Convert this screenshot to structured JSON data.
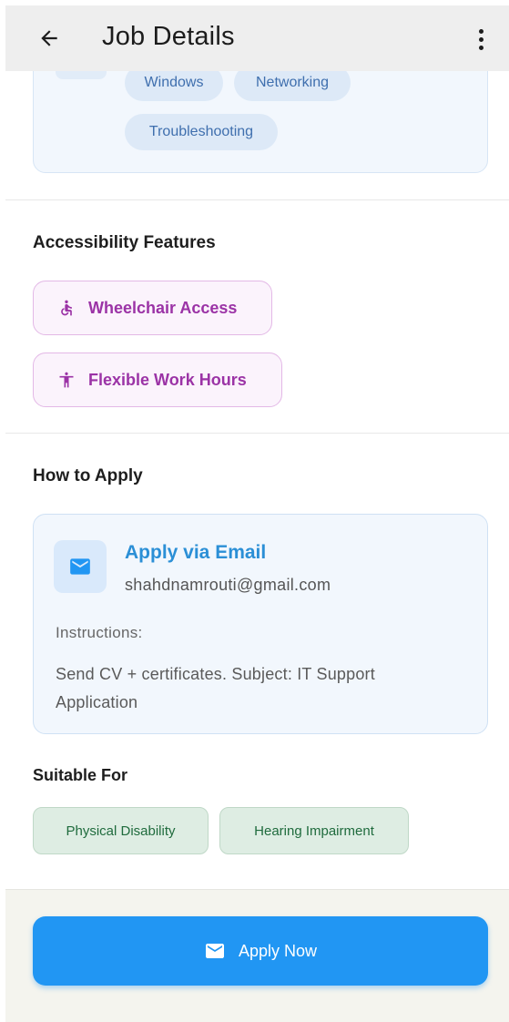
{
  "header": {
    "title": "Job Details"
  },
  "skills": [
    "Windows",
    "Networking",
    "Troubleshooting"
  ],
  "accessibility": {
    "title": "Accessibility Features",
    "features": [
      "Wheelchair Access",
      "Flexible Work Hours"
    ]
  },
  "how_to_apply": {
    "title": "How to Apply",
    "method": "Apply via Email",
    "email": "shahdnamrouti@gmail.com",
    "instructions_label": "Instructions:",
    "instructions_text": "Send CV + certificates. Subject: IT Support Application"
  },
  "suitable_for": {
    "title": "Suitable For",
    "items": [
      "Physical Disability",
      "Hearing Impairment"
    ]
  },
  "apply_button": {
    "label": "Apply Now"
  },
  "colors": {
    "primary": "#2196f3",
    "purple_accent": "#9b33a6",
    "green_accent": "#1f6b3d",
    "skill_chip_text": "#3f6fae"
  },
  "icons": {
    "back": "arrow-left-icon",
    "menu": "more-vert-icon",
    "wheelchair": "wheelchair-icon",
    "person": "accessibility-person-icon",
    "email": "mail-icon"
  }
}
